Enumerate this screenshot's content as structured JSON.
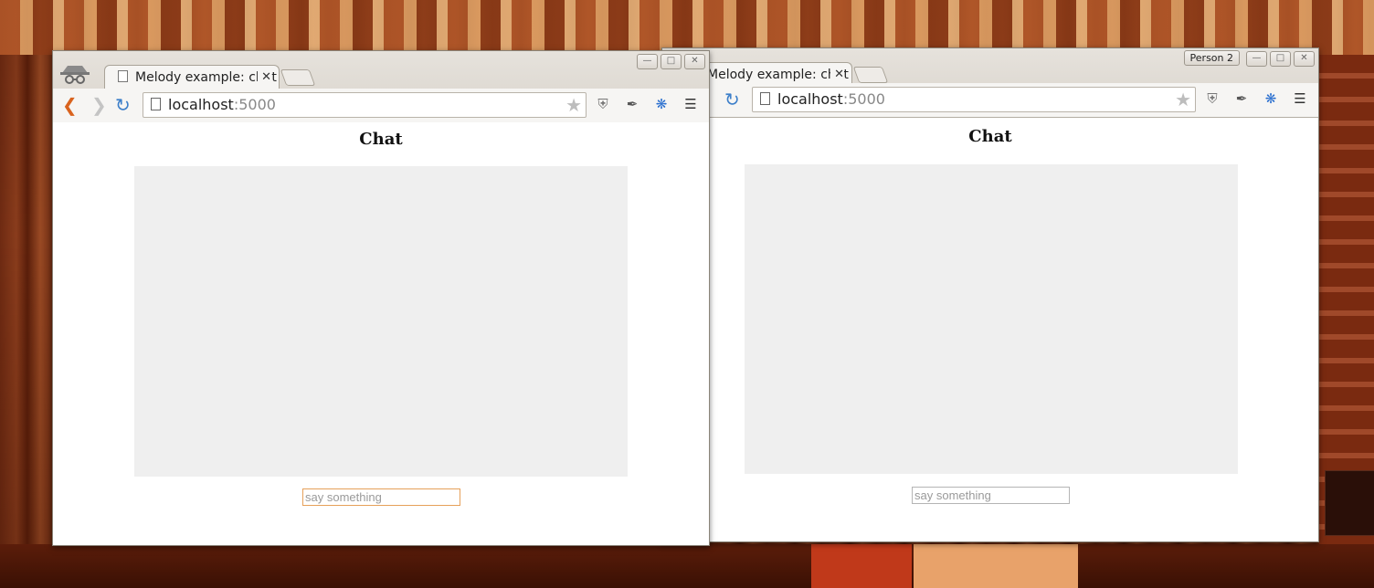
{
  "windows": [
    {
      "tab_title": "Melody example: chat",
      "url_host": "localhost",
      "url_port": ":5000",
      "page_heading": "Chat",
      "input_placeholder": "say something",
      "incognito": true
    },
    {
      "tab_title": "Melody example: chat",
      "url_host": "localhost",
      "url_port": ":5000",
      "page_heading": "Chat",
      "input_placeholder": "say something",
      "profile_label": "Person 2"
    }
  ],
  "icons": {
    "back": "back-arrow-icon",
    "forward": "forward-arrow-icon",
    "reload": "reload-icon",
    "bookmark": "star-icon",
    "ublock": "ublock-shield-icon",
    "eyedropper": "eyedropper-icon",
    "network": "network-extension-icon",
    "menu": "hamburger-menu-icon"
  },
  "colors": {
    "chat_bg": "#efefef",
    "back_arrow": "#d9631e",
    "reload": "#3d7fc9"
  }
}
